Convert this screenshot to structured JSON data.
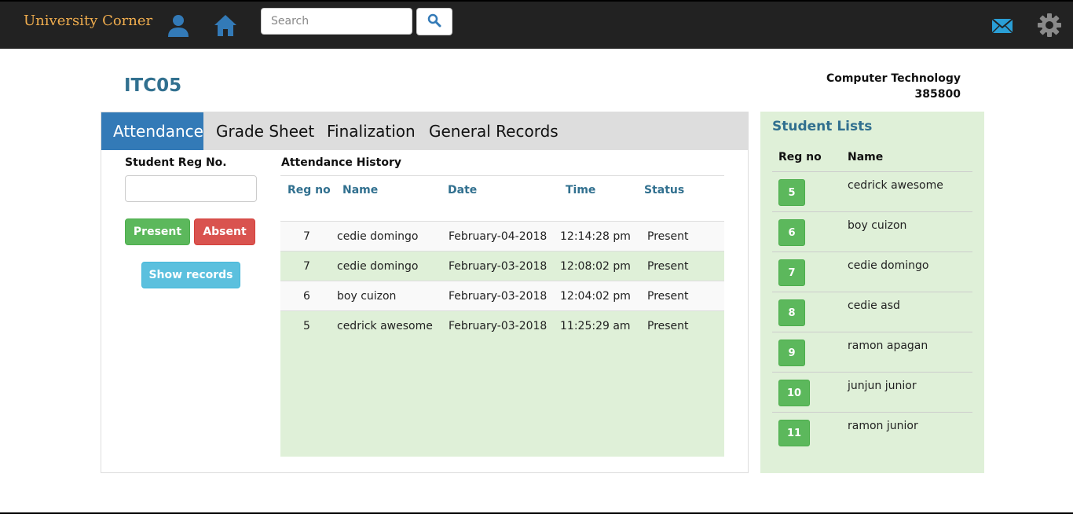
{
  "navbar": {
    "brand": "University Corner",
    "search": {
      "placeholder": "Search",
      "value": ""
    },
    "icons": [
      "user-icon",
      "home-icon",
      "search-icon",
      "mail-icon",
      "gear-icon"
    ]
  },
  "header": {
    "course_code": "ITC05",
    "department": "Computer Technology",
    "department_id": "385800"
  },
  "tabs": [
    {
      "label": "Attendance",
      "active": true
    },
    {
      "label": "Grade Sheet",
      "active": false
    },
    {
      "label": "Finalization",
      "active": false
    },
    {
      "label": "General Records",
      "active": false
    }
  ],
  "attendance_form": {
    "reg_label": "Student Reg No.",
    "reg_value": "",
    "present_label": "Present",
    "absent_label": "Absent",
    "show_records_label": "Show records"
  },
  "history": {
    "title": "Attendance History",
    "columns": [
      "Reg no",
      "Name",
      "Date",
      "Time",
      "Status"
    ],
    "rows": [
      {
        "reg": "7",
        "name": "cedie domingo",
        "date": "February-04-2018",
        "time": "12:14:28 pm",
        "status": "Present"
      },
      {
        "reg": "7",
        "name": "cedie domingo",
        "date": "February-03-2018",
        "time": "12:08:02 pm",
        "status": "Present"
      },
      {
        "reg": "6",
        "name": "boy cuizon",
        "date": "February-03-2018",
        "time": "12:04:02 pm",
        "status": "Present"
      },
      {
        "reg": "5",
        "name": "cedrick awesome",
        "date": "February-03-2018",
        "time": "11:25:29 am",
        "status": "Present"
      }
    ]
  },
  "student_list": {
    "title": "Student Lists",
    "columns": [
      "Reg no",
      "Name"
    ],
    "students": [
      {
        "reg": "5",
        "name": "cedrick awesome"
      },
      {
        "reg": "6",
        "name": "boy cuizon"
      },
      {
        "reg": "7",
        "name": "cedie domingo"
      },
      {
        "reg": "8",
        "name": "cedie asd"
      },
      {
        "reg": "9",
        "name": "ramon apagan"
      },
      {
        "reg": "10",
        "name": "junjun junior"
      },
      {
        "reg": "11",
        "name": "ramon junior"
      }
    ]
  },
  "colors": {
    "navbar": "#222222",
    "brand": "#f0ad4e",
    "primary": "#337ab7",
    "success": "#5cb85c",
    "danger": "#d9534f",
    "info": "#5bc0de",
    "highlight": "#dff0d8",
    "heading": "#31708f"
  }
}
